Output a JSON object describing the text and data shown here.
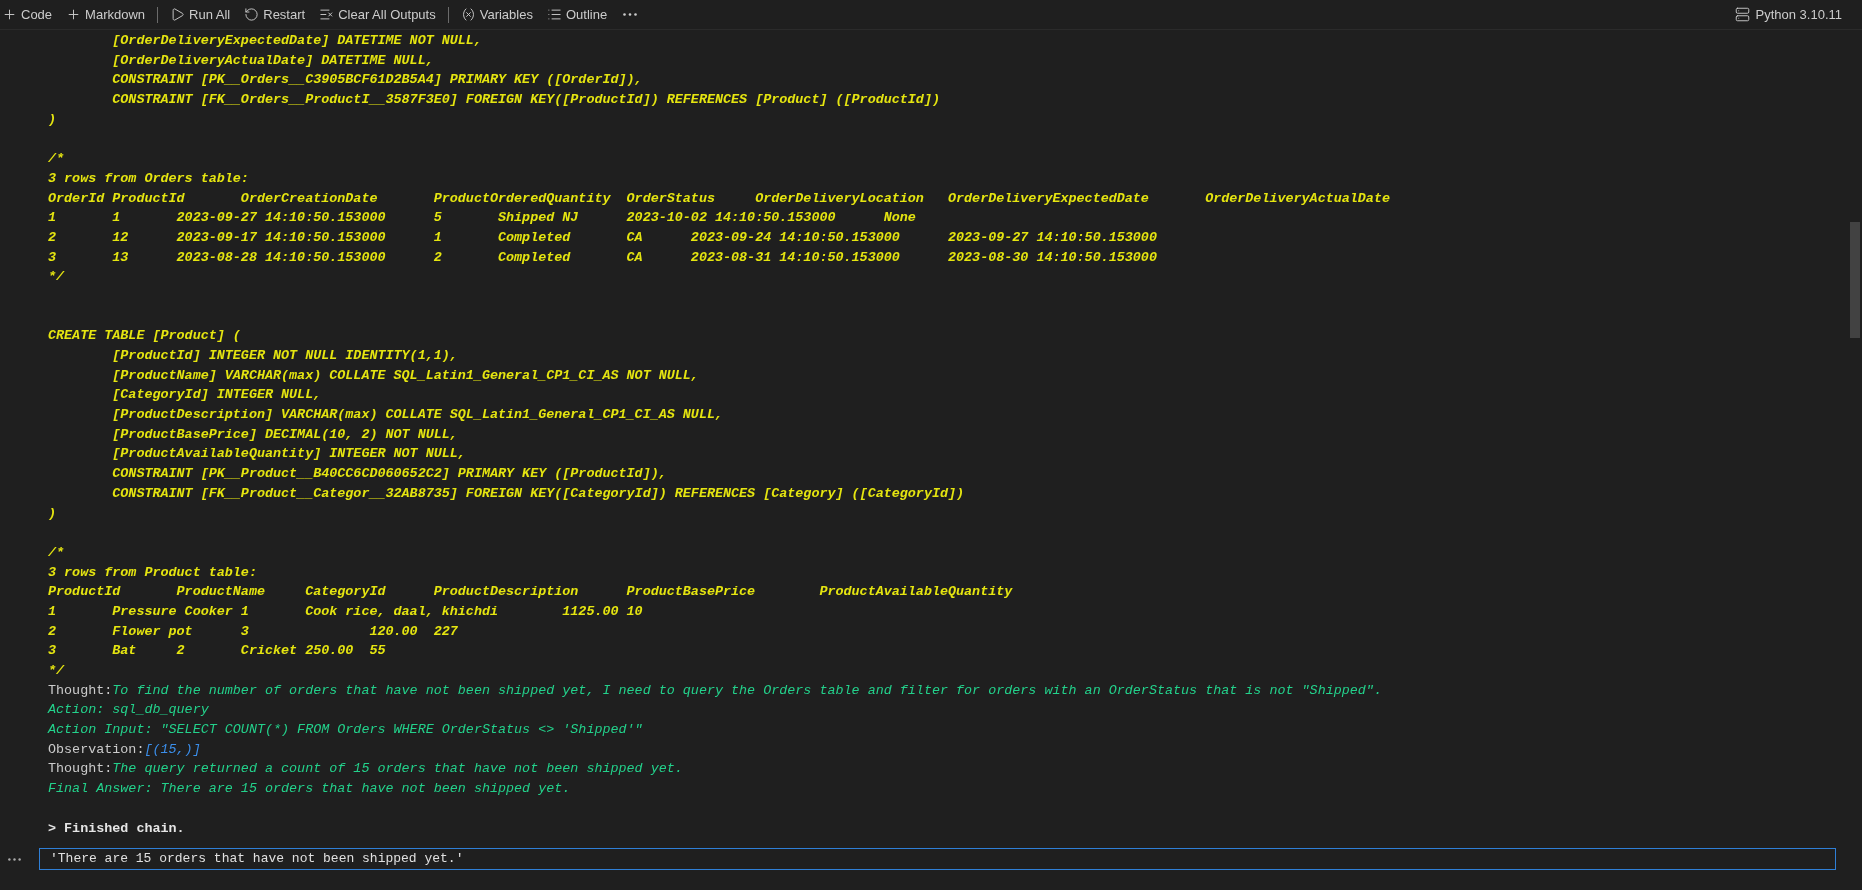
{
  "toolbar": {
    "items": [
      {
        "kind": "add",
        "label": "Code"
      },
      {
        "kind": "add",
        "label": "Markdown"
      },
      {
        "kind": "separator"
      },
      {
        "kind": "run",
        "label": "Run All"
      },
      {
        "kind": "restart",
        "label": "Restart"
      },
      {
        "kind": "clear",
        "label": "Clear All Outputs"
      },
      {
        "kind": "separator"
      },
      {
        "kind": "variables",
        "label": "Variables"
      },
      {
        "kind": "outline",
        "label": "Outline"
      },
      {
        "kind": "more"
      }
    ],
    "kernel": "Python 3.10.11"
  },
  "output": {
    "lines": [
      {
        "kind": "sql",
        "text": "\t[OrderDeliveryExpectedDate] DATETIME NOT NULL,"
      },
      {
        "kind": "sql",
        "text": "\t[OrderDeliveryActualDate] DATETIME NULL,"
      },
      {
        "kind": "sql",
        "text": "\tCONSTRAINT [PK__Orders__C3905BCF61D2B5A4] PRIMARY KEY ([OrderId]),"
      },
      {
        "kind": "sql",
        "text": "\tCONSTRAINT [FK__Orders__ProductI__3587F3E0] FOREIGN KEY([ProductId]) REFERENCES [Product] ([ProductId])"
      },
      {
        "kind": "sql",
        "text": ")"
      },
      {
        "kind": "blank"
      },
      {
        "kind": "sql",
        "text": "/*"
      },
      {
        "kind": "sql",
        "text": "3 rows from Orders table:"
      },
      {
        "kind": "sql",
        "text": "OrderId\tProductId\tOrderCreationDate\tProductOrderedQuantity\tOrderStatus\tOrderDeliveryLocation\tOrderDeliveryExpectedDate\tOrderDeliveryActualDate"
      },
      {
        "kind": "sql",
        "text": "1\t1\t2023-09-27 14:10:50.153000\t5\tShipped NJ\t2023-10-02 14:10:50.153000\tNone"
      },
      {
        "kind": "sql",
        "text": "2\t12\t2023-09-17 14:10:50.153000\t1\tCompleted\tCA\t2023-09-24 14:10:50.153000\t2023-09-27 14:10:50.153000"
      },
      {
        "kind": "sql",
        "text": "3\t13\t2023-08-28 14:10:50.153000\t2\tCompleted\tCA\t2023-08-31 14:10:50.153000\t2023-08-30 14:10:50.153000"
      },
      {
        "kind": "sql",
        "text": "*/"
      },
      {
        "kind": "blank"
      },
      {
        "kind": "blank"
      },
      {
        "kind": "sql",
        "text": "CREATE TABLE [Product] ("
      },
      {
        "kind": "sql",
        "text": "\t[ProductId] INTEGER NOT NULL IDENTITY(1,1),"
      },
      {
        "kind": "sql",
        "text": "\t[ProductName] VARCHAR(max) COLLATE SQL_Latin1_General_CP1_CI_AS NOT NULL,"
      },
      {
        "kind": "sql",
        "text": "\t[CategoryId] INTEGER NULL,"
      },
      {
        "kind": "sql",
        "text": "\t[ProductDescription] VARCHAR(max) COLLATE SQL_Latin1_General_CP1_CI_AS NULL,"
      },
      {
        "kind": "sql",
        "text": "\t[ProductBasePrice] DECIMAL(10, 2) NOT NULL,"
      },
      {
        "kind": "sql",
        "text": "\t[ProductAvailableQuantity] INTEGER NOT NULL,"
      },
      {
        "kind": "sql",
        "text": "\tCONSTRAINT [PK__Product__B40CC6CD060652C2] PRIMARY KEY ([ProductId]),"
      },
      {
        "kind": "sql",
        "text": "\tCONSTRAINT [FK__Product__Categor__32AB8735] FOREIGN KEY([CategoryId]) REFERENCES [Category] ([CategoryId])"
      },
      {
        "kind": "sql",
        "text": ")"
      },
      {
        "kind": "blank"
      },
      {
        "kind": "sql",
        "text": "/*"
      },
      {
        "kind": "sql",
        "text": "3 rows from Product table:"
      },
      {
        "kind": "sql",
        "text": "ProductId\tProductName\tCategoryId\tProductDescription\tProductBasePrice\tProductAvailableQuantity"
      },
      {
        "kind": "sql",
        "text": "1\tPressure Cooker\t1\tCook rice, daal, khichdi\t1125.00\t10"
      },
      {
        "kind": "sql",
        "text": "2\tFlower pot\t3\t\t120.00\t227"
      },
      {
        "kind": "sql",
        "text": "3\tBat\t2\tCricket\t250.00\t55"
      },
      {
        "kind": "sql",
        "text": "*/"
      },
      {
        "kind": "labeled",
        "label": "Thought:",
        "text": "To find the number of orders that have not been shipped yet, I need to query the Orders table and filter for orders with an OrderStatus that is not \"Shipped\".",
        "color": "#23d18b"
      },
      {
        "kind": "agent",
        "text": "Action: sql_db_query"
      },
      {
        "kind": "agent",
        "text": "Action Input: \"SELECT COUNT(*) FROM Orders WHERE OrderStatus <> 'Shipped'\""
      },
      {
        "kind": "labeled",
        "label": "Observation:",
        "text": "[(15,)]",
        "color": "#3b8eea"
      },
      {
        "kind": "labeled",
        "label": "Thought:",
        "text": "The query returned a count of 15 orders that have not been shipped yet.",
        "color": "#23d18b"
      },
      {
        "kind": "agent",
        "text": "Final Answer: There are 15 orders that have not been shipped yet."
      },
      {
        "kind": "blank"
      },
      {
        "kind": "chain",
        "text": "> Finished chain."
      }
    ]
  },
  "result_cell": {
    "value": "'There are 15 orders that have not been shipped yet.'"
  }
}
